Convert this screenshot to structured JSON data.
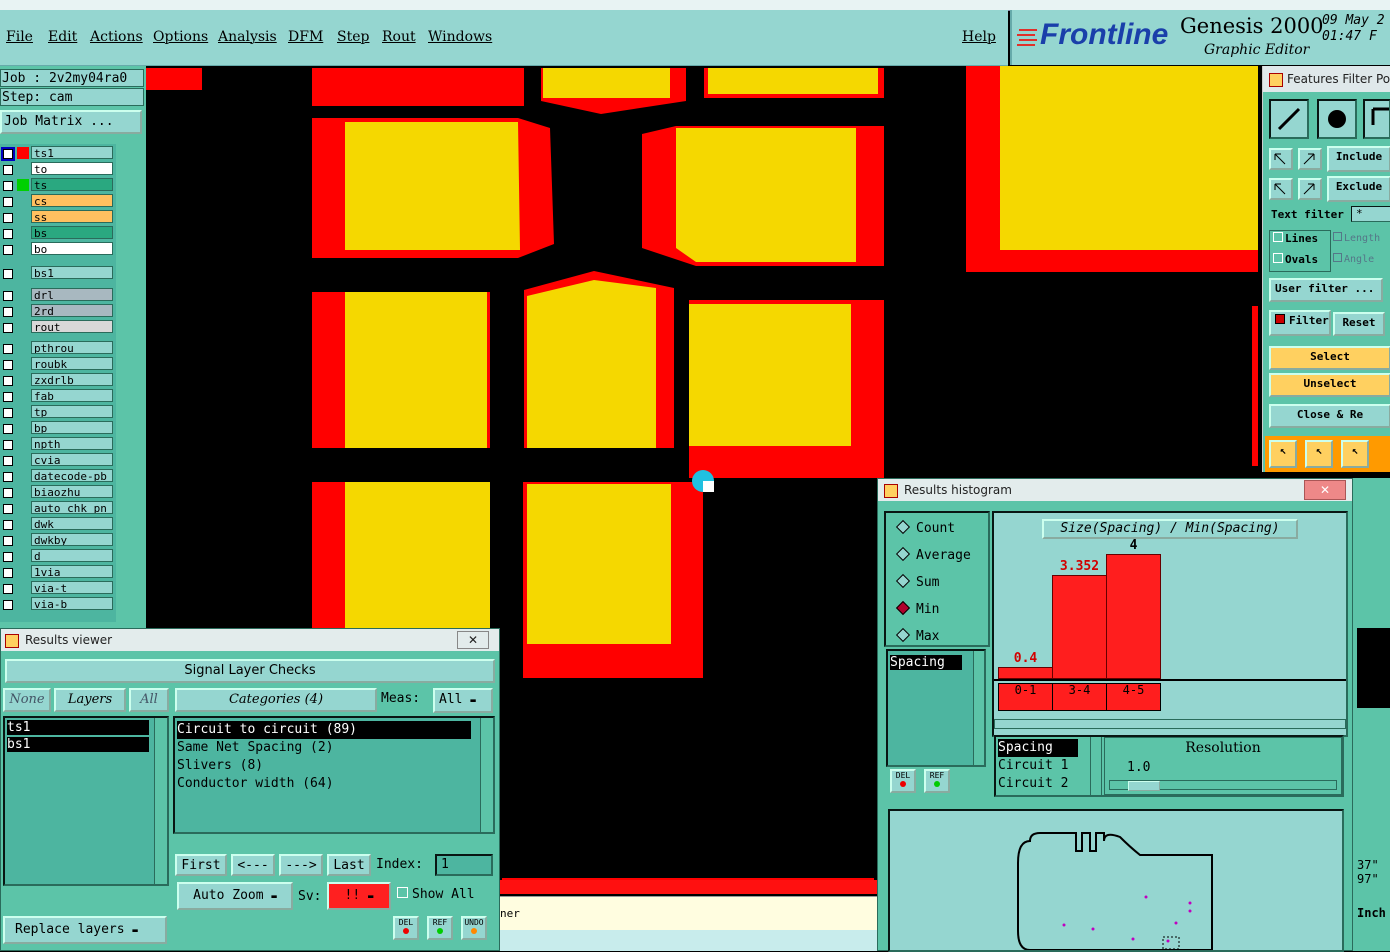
{
  "menubar": {
    "items": [
      "File",
      "Edit",
      "Actions",
      "Options",
      "Analysis",
      "DFM",
      "Step",
      "Rout",
      "Windows"
    ],
    "help": "Help"
  },
  "brand": {
    "logo": "Frontline",
    "product": "Genesis 2000",
    "subtitle": "Graphic Editor",
    "date": "09 May 2",
    "time": "01:47 F"
  },
  "job": {
    "job_label": "Job : 2v2my04ra0",
    "step_label": "Step: cam",
    "matrix_button": "Job Matrix ..."
  },
  "layers": [
    {
      "name": "ts1",
      "mark": "#ff0000",
      "bg": "#95d6d0"
    },
    {
      "name": "to",
      "mark": "",
      "bg": "#ffffff"
    },
    {
      "name": "ts",
      "mark": "#00d000",
      "bg": "#2aa880"
    },
    {
      "name": "cs",
      "mark": "",
      "bg": "#ffc060"
    },
    {
      "name": "ss",
      "mark": "",
      "bg": "#ffc060"
    },
    {
      "name": "bs",
      "mark": "",
      "bg": "#2aa880"
    },
    {
      "name": "bo",
      "mark": "",
      "bg": "#ffffff"
    },
    {
      "name": "bs1",
      "mark": "",
      "bg": "#95d6d0"
    },
    {
      "name": "drl",
      "mark": "",
      "bg": "#a8b8c0"
    },
    {
      "name": "2rd",
      "mark": "",
      "bg": "#a8b8c0"
    },
    {
      "name": "rout",
      "mark": "",
      "bg": "#d8d8d8"
    },
    {
      "name": "pthrou",
      "mark": "",
      "bg": "#95d6d0"
    },
    {
      "name": "roubk",
      "mark": "",
      "bg": "#95d6d0"
    },
    {
      "name": "zxdrlb",
      "mark": "",
      "bg": "#95d6d0"
    },
    {
      "name": "fab",
      "mark": "",
      "bg": "#95d6d0"
    },
    {
      "name": "tp",
      "mark": "",
      "bg": "#95d6d0"
    },
    {
      "name": "bp",
      "mark": "",
      "bg": "#95d6d0"
    },
    {
      "name": "npth",
      "mark": "",
      "bg": "#95d6d0"
    },
    {
      "name": "cvia",
      "mark": "",
      "bg": "#95d6d0"
    },
    {
      "name": "datecode-pb",
      "mark": "",
      "bg": "#95d6d0"
    },
    {
      "name": "biaozhu",
      "mark": "",
      "bg": "#95d6d0"
    },
    {
      "name": "auto_chk_pn",
      "mark": "",
      "bg": "#95d6d0"
    },
    {
      "name": "dwk",
      "mark": "",
      "bg": "#95d6d0"
    },
    {
      "name": "dwkby",
      "mark": "",
      "bg": "#95d6d0"
    },
    {
      "name": "d",
      "mark": "",
      "bg": "#95d6d0"
    },
    {
      "name": "1via",
      "mark": "",
      "bg": "#95d6d0"
    },
    {
      "name": "via-t",
      "mark": "",
      "bg": "#95d6d0"
    },
    {
      "name": "via-b",
      "mark": "",
      "bg": "#95d6d0"
    }
  ],
  "features_filter": {
    "title": "Features Filter Po",
    "include": "Include",
    "exclude": "Exclude",
    "text_filter_label": "Text filter",
    "text_filter_value": "*",
    "lines": "Lines",
    "ovals": "Ovals",
    "length": "Length",
    "angle": "Angle",
    "user_filter": "User filter ...",
    "filter": "Filter",
    "reset": "Reset",
    "select": "Select",
    "unselect": "Unselect",
    "close": "Close & Re"
  },
  "results_viewer": {
    "title": "Results viewer",
    "header": "Signal Layer Checks",
    "none_btn": "None",
    "layers_btn": "Layers",
    "all_btn": "All",
    "categories_btn": "Categories (4)",
    "meas_label": "Meas:",
    "meas_value": "All",
    "layer_items": [
      "ts1",
      "bs1"
    ],
    "categories": [
      "Circuit to circuit (89)",
      "Same Net Spacing (2)",
      "Slivers (8)",
      "Conductor width (64)"
    ],
    "first": "First",
    "prev": "<---",
    "next": "--->",
    "last": "Last",
    "index_label": "Index:",
    "index_value": "1",
    "auto_zoom": "Auto Zoom",
    "sv_label": "Sv:",
    "sv_value": "!!",
    "show_all": "Show All",
    "replace_layers": "Replace layers",
    "del": "DEL",
    "ref": "REF",
    "undo": "UNDO"
  },
  "histogram": {
    "title": "Results histogram",
    "modes": [
      "Count",
      "Average",
      "Sum",
      "Min",
      "Max"
    ],
    "selected_mode": "Min",
    "measure_items": [
      "Spacing"
    ],
    "del": "DEL",
    "ref": "REF",
    "chart_title": "Size(Spacing) / Min(Spacing)",
    "resolution_label": "Resolution",
    "resolution_value": "1.0",
    "sort_items": [
      "Spacing",
      "Circuit 1",
      "Circuit 2"
    ]
  },
  "chart_data": {
    "type": "bar",
    "title": "Size(Spacing) / Min(Spacing)",
    "categories": [
      "0-1",
      "3-4",
      "4-5"
    ],
    "values": [
      0.4,
      3.352,
      4
    ],
    "data_labels": [
      "0.4",
      "3.352",
      "4"
    ],
    "ylim": [
      0,
      4.3
    ],
    "color": "#ff1e1e"
  },
  "status": {
    "text": "ner",
    "right_readout_1": "37\"",
    "right_readout_2": "97\"",
    "units": "Inch"
  }
}
